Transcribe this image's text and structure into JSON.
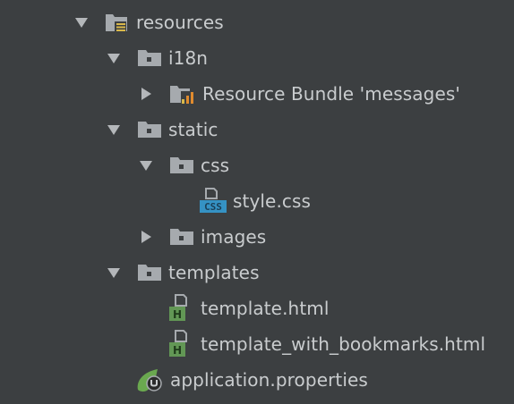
{
  "project_tree": {
    "items": [
      {
        "label": "resources",
        "icon": "resources-folder-icon",
        "expanded": true
      },
      {
        "label": "i18n",
        "icon": "folder-icon",
        "expanded": true
      },
      {
        "label": "Resource Bundle 'messages'",
        "icon": "resource-bundle-icon",
        "expanded": false
      },
      {
        "label": "static",
        "icon": "folder-icon",
        "expanded": true
      },
      {
        "label": "css",
        "icon": "folder-icon",
        "expanded": true
      },
      {
        "label": "style.css",
        "icon": "css-file-icon"
      },
      {
        "label": "images",
        "icon": "folder-icon",
        "expanded": false
      },
      {
        "label": "templates",
        "icon": "folder-icon",
        "expanded": true
      },
      {
        "label": "template.html",
        "icon": "html-file-icon"
      },
      {
        "label": "template_with_bookmarks.html",
        "icon": "html-file-icon"
      },
      {
        "label": "application.properties",
        "icon": "spring-properties-icon"
      }
    ]
  },
  "icon_badges": {
    "css": "CSS",
    "html": "H"
  },
  "colors": {
    "background": "#3c3f41",
    "text": "#c9ccce",
    "folder": "#a6aaae",
    "arrow": "#b4b7ba",
    "css_badge": "#3592c4",
    "html_badge": "#629755",
    "spring": "#6aa84f",
    "bundle_orange": "#e08b2e",
    "bundle_yellow": "#d9b84a"
  }
}
